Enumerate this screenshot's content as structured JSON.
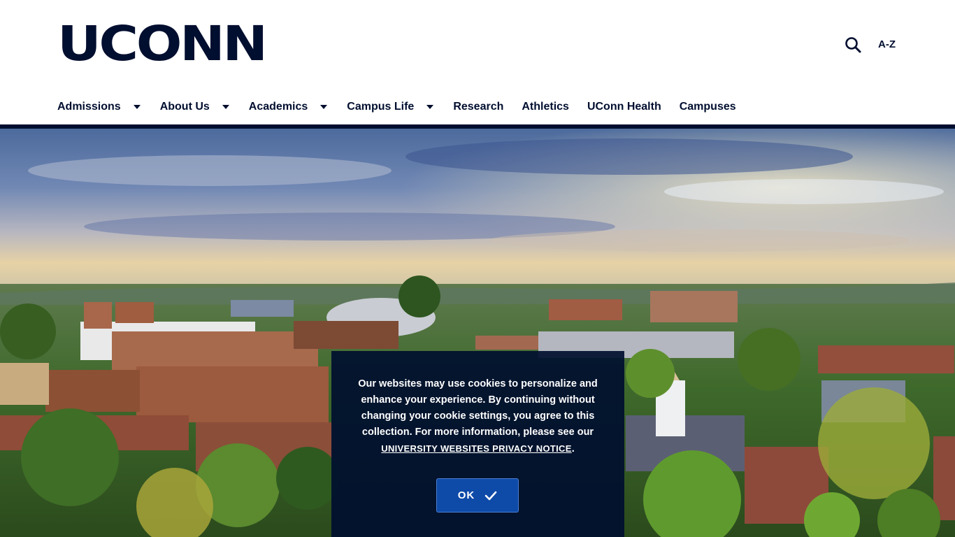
{
  "header": {
    "logo_text": "UCONN",
    "search_icon": "search-icon",
    "az_label": "A-Z"
  },
  "nav": {
    "items": [
      {
        "label": "Admissions",
        "has_dropdown": true
      },
      {
        "label": "About Us",
        "has_dropdown": true
      },
      {
        "label": "Academics",
        "has_dropdown": true
      },
      {
        "label": "Campus Life",
        "has_dropdown": true
      },
      {
        "label": "Research",
        "has_dropdown": false
      },
      {
        "label": "Athletics",
        "has_dropdown": false
      },
      {
        "label": "UConn Health",
        "has_dropdown": false
      },
      {
        "label": "Campuses",
        "has_dropdown": false
      }
    ]
  },
  "cookie": {
    "message": "Our websites may use cookies to personalize and enhance your experience. By continuing without changing your cookie settings, you agree to this collection. For more information, please see our",
    "link_text": "University Websites Privacy Notice",
    "after_link": ".",
    "ok_label": "OK",
    "ok_icon": "checkmark-icon"
  },
  "colors": {
    "brand_navy": "#000e2f",
    "button_blue": "#0e4aa8"
  }
}
